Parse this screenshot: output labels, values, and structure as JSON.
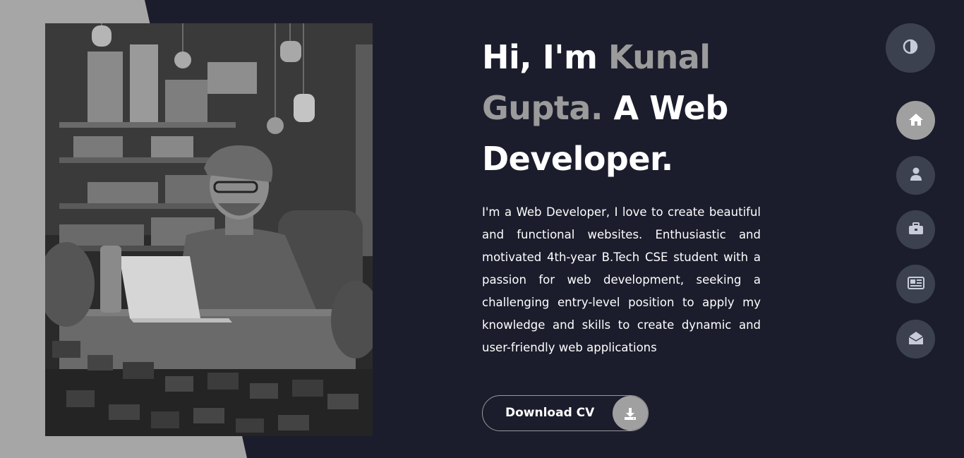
{
  "hero": {
    "greeting": "Hi, I'm ",
    "name_line1": "Kunal",
    "name_line2": "Gupta.",
    "role_prefix": " A Web",
    "role_suffix": "Developer.",
    "bio": "I'm a Web Developer, I love to create beautiful and functional websites. Enthusiastic and motivated 4th-year B.Tech CSE student with a passion for web development, seeking a challenging entry-level position to apply my knowledge and skills to create dynamic and user-friendly web applications"
  },
  "download": {
    "label": "Download CV",
    "icon": "download-icon"
  },
  "theme_toggle": {
    "icon": "contrast-icon"
  },
  "nav": [
    {
      "icon": "home-icon",
      "active": true
    },
    {
      "icon": "user-icon",
      "active": false
    },
    {
      "icon": "briefcase-icon",
      "active": false
    },
    {
      "icon": "newspaper-icon",
      "active": false
    },
    {
      "icon": "envelope-open-icon",
      "active": false
    }
  ],
  "colors": {
    "background": "#1b1d2c",
    "slant": "#a6a6a6",
    "accent_text": "#9b9b9b",
    "nav_bg": "#3c4150",
    "nav_active": "#a0a0a0",
    "icon_color": "#c7ccd8"
  }
}
